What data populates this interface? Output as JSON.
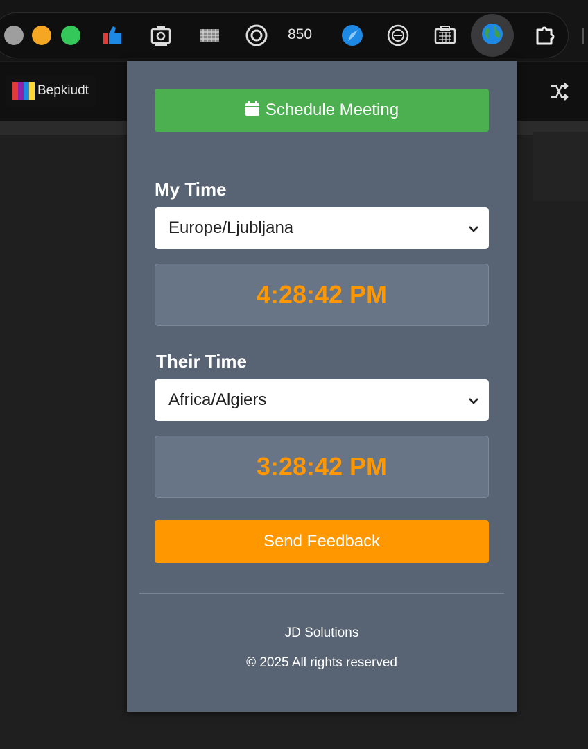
{
  "toolbar": {
    "counter_text": "850",
    "extensions": [
      {
        "name": "thumbs-up-icon"
      },
      {
        "name": "camera-icon"
      },
      {
        "name": "pattern-icon"
      },
      {
        "name": "target-icon"
      },
      {
        "name": "compass-icon"
      },
      {
        "name": "badge-icon"
      },
      {
        "name": "calendar-box-icon"
      },
      {
        "name": "globe-icon"
      },
      {
        "name": "puzzle-icon"
      }
    ]
  },
  "page": {
    "site_name": "Bepkiudt"
  },
  "popup": {
    "schedule_button": "Schedule Meeting",
    "my_time": {
      "label": "My Time",
      "timezone": "Europe/Ljubljana",
      "time": "4:28:42 PM"
    },
    "their_time": {
      "label": "Their Time",
      "timezone": "Africa/Algiers",
      "time": "3:28:42 PM"
    },
    "feedback_button": "Send Feedback",
    "footer": {
      "company": "JD Solutions",
      "copyright": "© 2025 All rights reserved"
    }
  },
  "colors": {
    "popup_bg": "#586474",
    "schedule_green": "#4caf50",
    "feedback_orange": "#ff9800",
    "time_orange": "#ff9800"
  }
}
